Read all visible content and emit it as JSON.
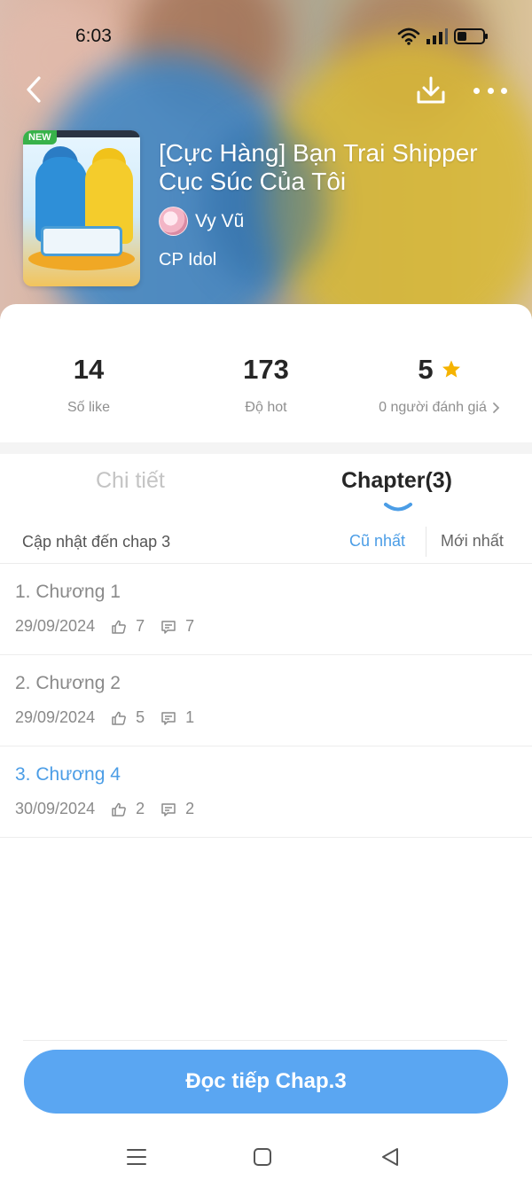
{
  "status_bar": {
    "time": "6:03"
  },
  "story": {
    "title": "[Cực Hàng] Bạn Trai Shipper Cục Súc Của Tôi",
    "author": "Vy Vũ",
    "genre": "CP Idol",
    "cover_badge": "NEW"
  },
  "stats": {
    "likes": {
      "value": "14",
      "label": "Số like"
    },
    "hot": {
      "value": "173",
      "label": "Độ hot"
    },
    "rating": {
      "value": "5",
      "label": "0 người đánh giá"
    }
  },
  "tabs": {
    "detail": "Chi tiết",
    "chapters": "Chapter(3)"
  },
  "sort": {
    "updated": "Cập nhật đến chap 3",
    "oldest": "Cũ nhất",
    "newest": "Mới nhất"
  },
  "chapters": [
    {
      "title": "1. Chương 1",
      "date": "29/09/2024",
      "likes": "7",
      "comments": "7"
    },
    {
      "title": "2. Chương 2",
      "date": "29/09/2024",
      "likes": "5",
      "comments": "1"
    },
    {
      "title": "3. Chương 4",
      "date": "30/09/2024",
      "likes": "2",
      "comments": "2"
    }
  ],
  "continue_button": "Đọc tiếp Chap.3",
  "icons": {
    "back": "chevron-left-icon",
    "download": "download-icon",
    "more": "more-dots-icon",
    "star": "star-icon",
    "like": "thumbs-up-icon",
    "comment": "comment-icon"
  },
  "colors": {
    "accent": "#5aa6f2",
    "link": "#4b9de6",
    "star": "#f5b301",
    "new_badge": "#38b24a"
  }
}
